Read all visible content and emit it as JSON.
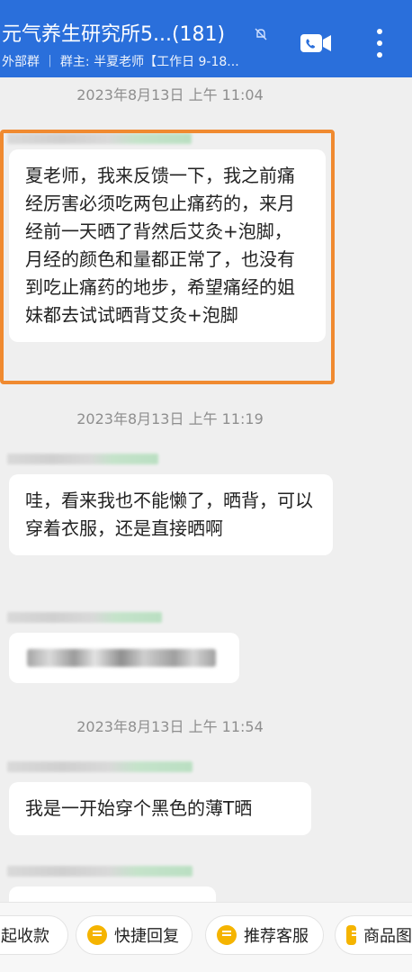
{
  "header": {
    "title": "元气养生研究所5...(181)",
    "subtitle": "外部群 ｜ 群主: 半夏老师【工作日 9-18..."
  },
  "messages": [
    {
      "timestamp": "2023年8月13日  上午 11:04",
      "text": "夏老师，我来反馈一下，我之前痛经厉害必须吃两包止痛药的，来月经前一天晒了背然后艾灸+泡脚，月经的颜色和量都正常了，也没有到吃止痛药的地步，希望痛经的姐妹都去试试晒背艾灸+泡脚"
    },
    {
      "timestamp": "2023年8月13日  上午 11:19",
      "text": "哇，看来我也不能懒了，晒背，可以穿着衣服，还是直接晒啊"
    },
    {
      "timestamp": "2023年8月13日  上午 11:54",
      "text": "我是一开始穿个黑色的薄T晒"
    }
  ],
  "quick_replies": [
    {
      "label": "起收款",
      "icon": ""
    },
    {
      "label": "快捷回复",
      "icon": "quick-reply-icon"
    },
    {
      "label": "推荐客服",
      "icon": "service-icon"
    },
    {
      "label": "商品图",
      "icon": "product-icon"
    }
  ],
  "colors": {
    "header": "#2a6fdb",
    "highlight": "#f08a30",
    "chip_icon": "#f5b400"
  }
}
